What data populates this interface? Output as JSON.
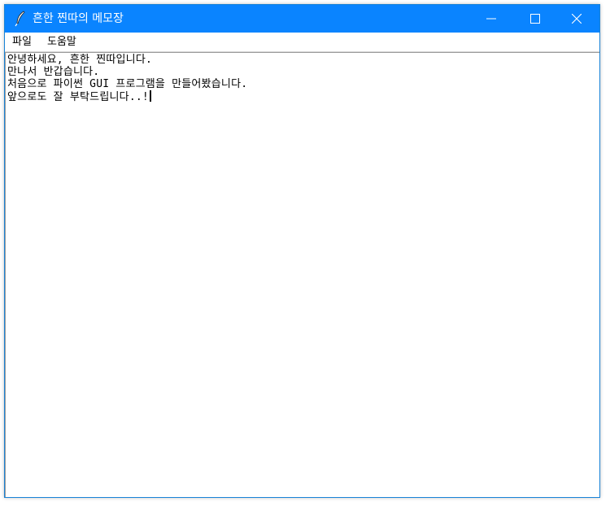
{
  "window": {
    "title": "흔한 찐따의 메모장",
    "accent_color": "#0a84ff",
    "app_icon": "feather-quill-icon",
    "controls": [
      "minimize-icon",
      "maximize-icon",
      "close-icon"
    ]
  },
  "menubar": {
    "items": [
      "파일",
      "도움말"
    ]
  },
  "editor": {
    "lines": [
      "안녕하세요, 흔한 찐따입니다.",
      "만나서 반갑습니다.",
      "처음으로 파이썬 GUI 프로그램을 만들어봤습니다.",
      "앞으로도 잘 부탁드립니다..!"
    ]
  }
}
